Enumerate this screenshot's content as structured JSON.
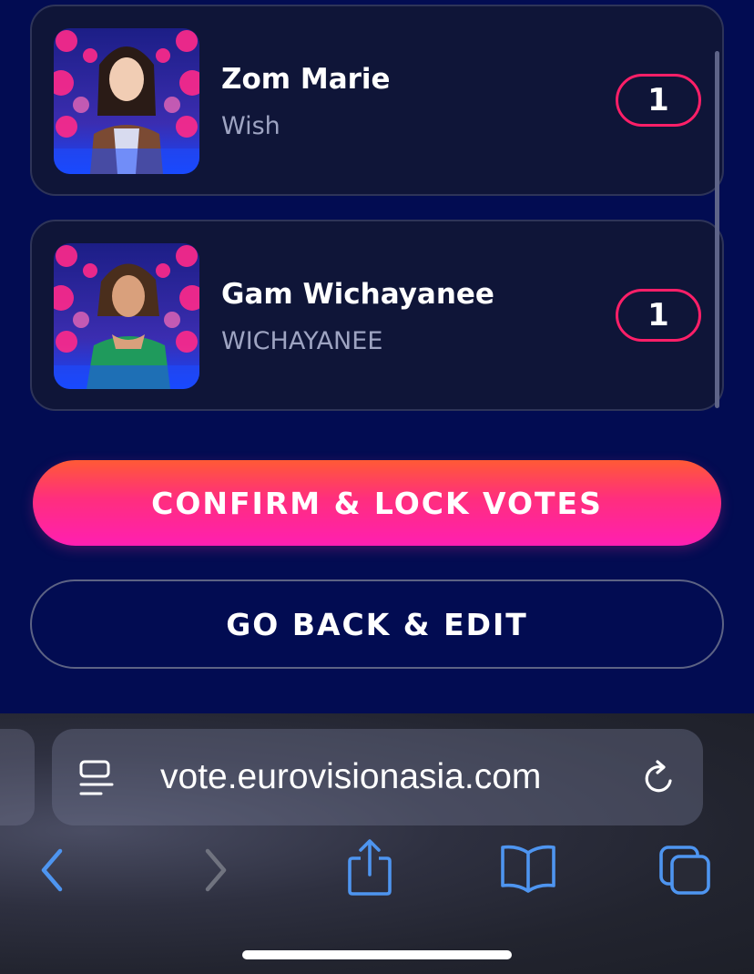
{
  "entries": [
    {
      "artist": "Zom Marie",
      "song": "Wish",
      "points": "1"
    },
    {
      "artist": "Gam Wichayanee",
      "song": "WICHAYANEE",
      "points": "1"
    }
  ],
  "actions": {
    "confirm_label": "CONFIRM & LOCK VOTES",
    "back_label": "GO BACK & EDIT"
  },
  "browser": {
    "url": "vote.eurovisionasia.com",
    "icons": [
      "reader-mode-icon",
      "reload-icon",
      "back-arrow-icon",
      "forward-arrow-icon",
      "share-icon",
      "bookmarks-icon",
      "tabs-icon"
    ]
  },
  "colors": {
    "background": "#020c52",
    "card": "#0f1538",
    "badge_border": "#ff1f68",
    "confirm_gradient_top": "#ff5a35",
    "confirm_gradient_bottom": "#ff1fb1",
    "toolbar_icon": "#4e95f0"
  }
}
